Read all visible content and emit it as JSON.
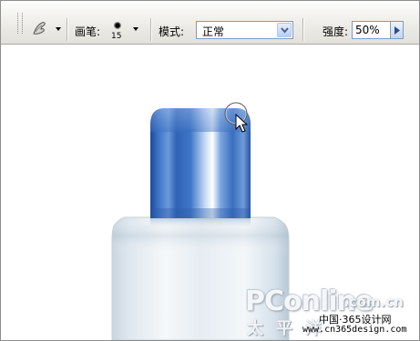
{
  "toolbar": {
    "tool_preset_icon": "smudge-finger-icon",
    "brush_label": "画笔:",
    "brush_size": "15",
    "mode_label": "模式:",
    "mode_value": "正常",
    "strength_label": "强度:",
    "strength_value": "50%"
  },
  "watermark": {
    "brand": "PConline",
    "domain": ".com.cn",
    "brand_cn": "太平洋"
  },
  "credit": {
    "name": "中国·365设计网",
    "url": "www.cn365design.com"
  },
  "colors": {
    "cap_blue": "#3a6fc0",
    "bottle_body": "#e4ecf2",
    "toolbar_bg": "#ecebe6"
  }
}
